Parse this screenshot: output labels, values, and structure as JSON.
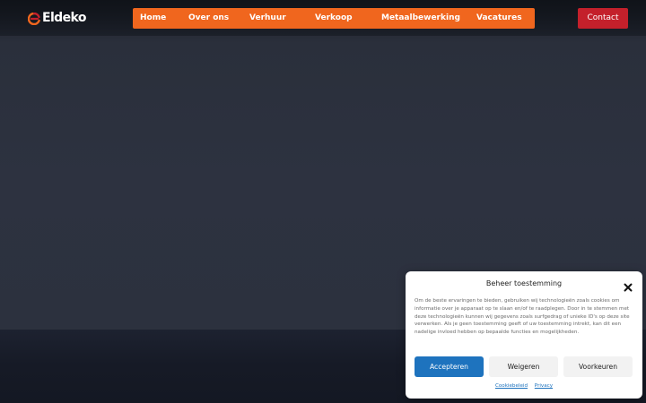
{
  "header": {
    "logo_text": "Eldeko",
    "logo_icon": "eldeko-e-logo-icon",
    "nav_items": [
      {
        "label": "Home"
      },
      {
        "label": "Over ons"
      },
      {
        "label": "Verhuur"
      },
      {
        "label": "Verkoop"
      },
      {
        "label": "Metaalbewerking"
      },
      {
        "label": "Vacatures"
      }
    ],
    "contact_label": "Contact"
  },
  "cookie_banner": {
    "title": "Beheer toestemming",
    "close_icon": "close-icon",
    "body": "Om de beste ervaringen te bieden, gebruiken wij technologieën zoals cookies om informatie over je apparaat op te slaan en/of te raadplegen. Door in te stemmen met deze technologieën kunnen wij gegevens zoals surfgedrag of unieke ID's op deze site verwerken. Als je geen toestemming geeft of uw toestemming intrekt, kan dit een nadelige invloed hebben op bepaalde functies en mogelijkheden.",
    "accept_label": "Accepteren",
    "deny_label": "Weigeren",
    "preferences_label": "Voorkeuren",
    "links": [
      {
        "label": "Cookiebeleid"
      },
      {
        "label": "Privacy"
      }
    ]
  },
  "colors": {
    "nav_bg": "#f0661e",
    "contact_bg": "#c4202b",
    "accept_bg": "#1e73be",
    "hero_bg": "#2d3240",
    "footer_bg": "#141823"
  }
}
